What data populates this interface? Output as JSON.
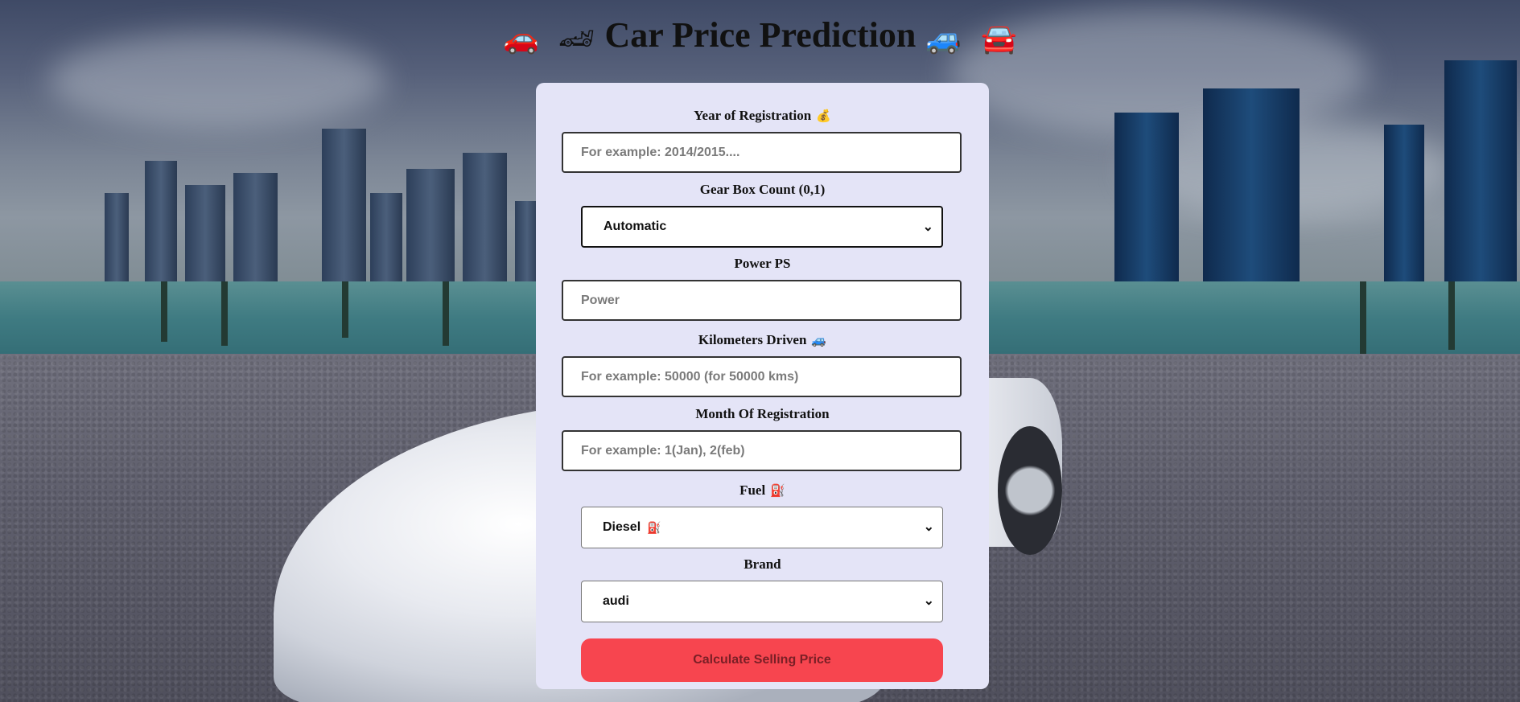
{
  "header": {
    "title": "Car Price Prediction",
    "emoji_left_1": "🚗",
    "emoji_left_2": "🏎",
    "emoji_right_1": "🚙",
    "emoji_right_2": "🚘"
  },
  "form": {
    "year": {
      "label": "Year of Registration",
      "icon": "💰",
      "placeholder": "For example: 2014/2015...."
    },
    "gearbox": {
      "label": "Gear Box Count (0,1)",
      "selected": "Automatic"
    },
    "power": {
      "label": "Power PS",
      "placeholder": "Power"
    },
    "kms": {
      "label": "Kilometers Driven",
      "icon": "🚙",
      "placeholder": "For example: 50000 (for 50000 kms)"
    },
    "month": {
      "label": "Month Of Registration",
      "placeholder": "For example: 1(Jan), 2(feb)"
    },
    "fuel": {
      "label": "Fuel",
      "icon": "⛽",
      "selected": "Diesel",
      "selected_icon": "⛽"
    },
    "brand": {
      "label": "Brand",
      "selected": "audi"
    },
    "submit_label": "Calculate Selling Price"
  }
}
